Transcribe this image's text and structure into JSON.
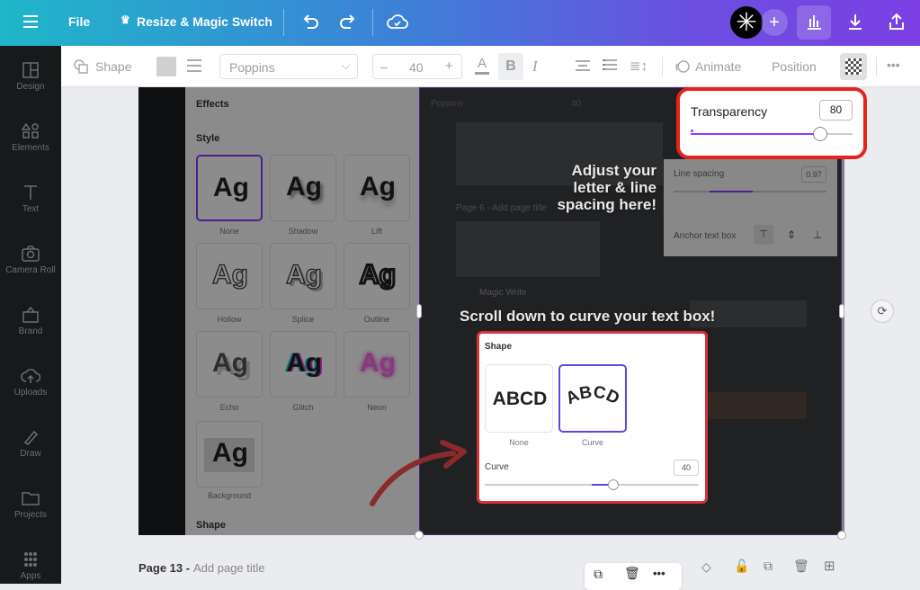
{
  "topbar": {
    "menu_icon": "hamburger-icon",
    "file_label": "File",
    "resize_label": "Resize & Magic Switch",
    "undo_icon": "undo-icon",
    "redo_icon": "redo-icon",
    "cloud_icon": "cloud-check-icon",
    "add_icon": "plus-icon",
    "insights_icon": "bar-chart-icon",
    "download_icon": "download-icon",
    "share_icon": "share-icon"
  },
  "toolbar": {
    "shape_label": "Shape",
    "font_name": "Poppins",
    "font_size": "40",
    "decrease_label": "–",
    "increase_label": "+",
    "bold_label": "B",
    "italic_label": "I",
    "animate_label": "Animate",
    "position_label": "Position",
    "more_label": "•••"
  },
  "sidebar": {
    "items": [
      {
        "label": "Design"
      },
      {
        "label": "Elements"
      },
      {
        "label": "Text"
      },
      {
        "label": "Camera Roll"
      },
      {
        "label": "Brand"
      },
      {
        "label": "Uploads"
      },
      {
        "label": "Draw"
      },
      {
        "label": "Projects"
      },
      {
        "label": "Apps"
      }
    ]
  },
  "effects_panel": {
    "title": "Effects",
    "style_heading": "Style",
    "sample": "Ag",
    "styles": [
      {
        "label": "None"
      },
      {
        "label": "Shadow"
      },
      {
        "label": "Lift"
      },
      {
        "label": "Hollow"
      },
      {
        "label": "Splice"
      },
      {
        "label": "Outline"
      },
      {
        "label": "Echo"
      },
      {
        "label": "Glitch"
      },
      {
        "label": "Neon"
      },
      {
        "label": "Background"
      }
    ],
    "shape_heading": "Shape"
  },
  "spacing_panel": {
    "line_spacing_label": "Line spacing",
    "line_spacing_value": "0.97",
    "anchor_label": "Anchor text box"
  },
  "transparency_popup": {
    "label": "Transparency",
    "value": "80",
    "level_percent": 80
  },
  "callouts": {
    "adjust_text": "Adjust your letter & line spacing here!",
    "curve_text": "Scroll down to curve your text box!"
  },
  "shape_box": {
    "heading": "Shape",
    "options": [
      {
        "sample": "ABCD",
        "label": "None"
      },
      {
        "sample": "ABCD",
        "label": "Curve"
      }
    ],
    "curve_label": "Curve",
    "curve_value": "40",
    "curve_percent": 60
  },
  "background_page": {
    "font_name": "Poppins",
    "font_size": "40",
    "page_label": "Page 6 - Add page title",
    "magic_write": "Magic Write"
  },
  "footer": {
    "page_label": "Page 13 -",
    "page_title_placeholder": "Add page title",
    "more_label": "•••"
  },
  "colors": {
    "accent": "#8b3dff",
    "highlight": "#e5231d",
    "topbar_start": "#1fb6c9",
    "topbar_end": "#7b3fe4"
  }
}
